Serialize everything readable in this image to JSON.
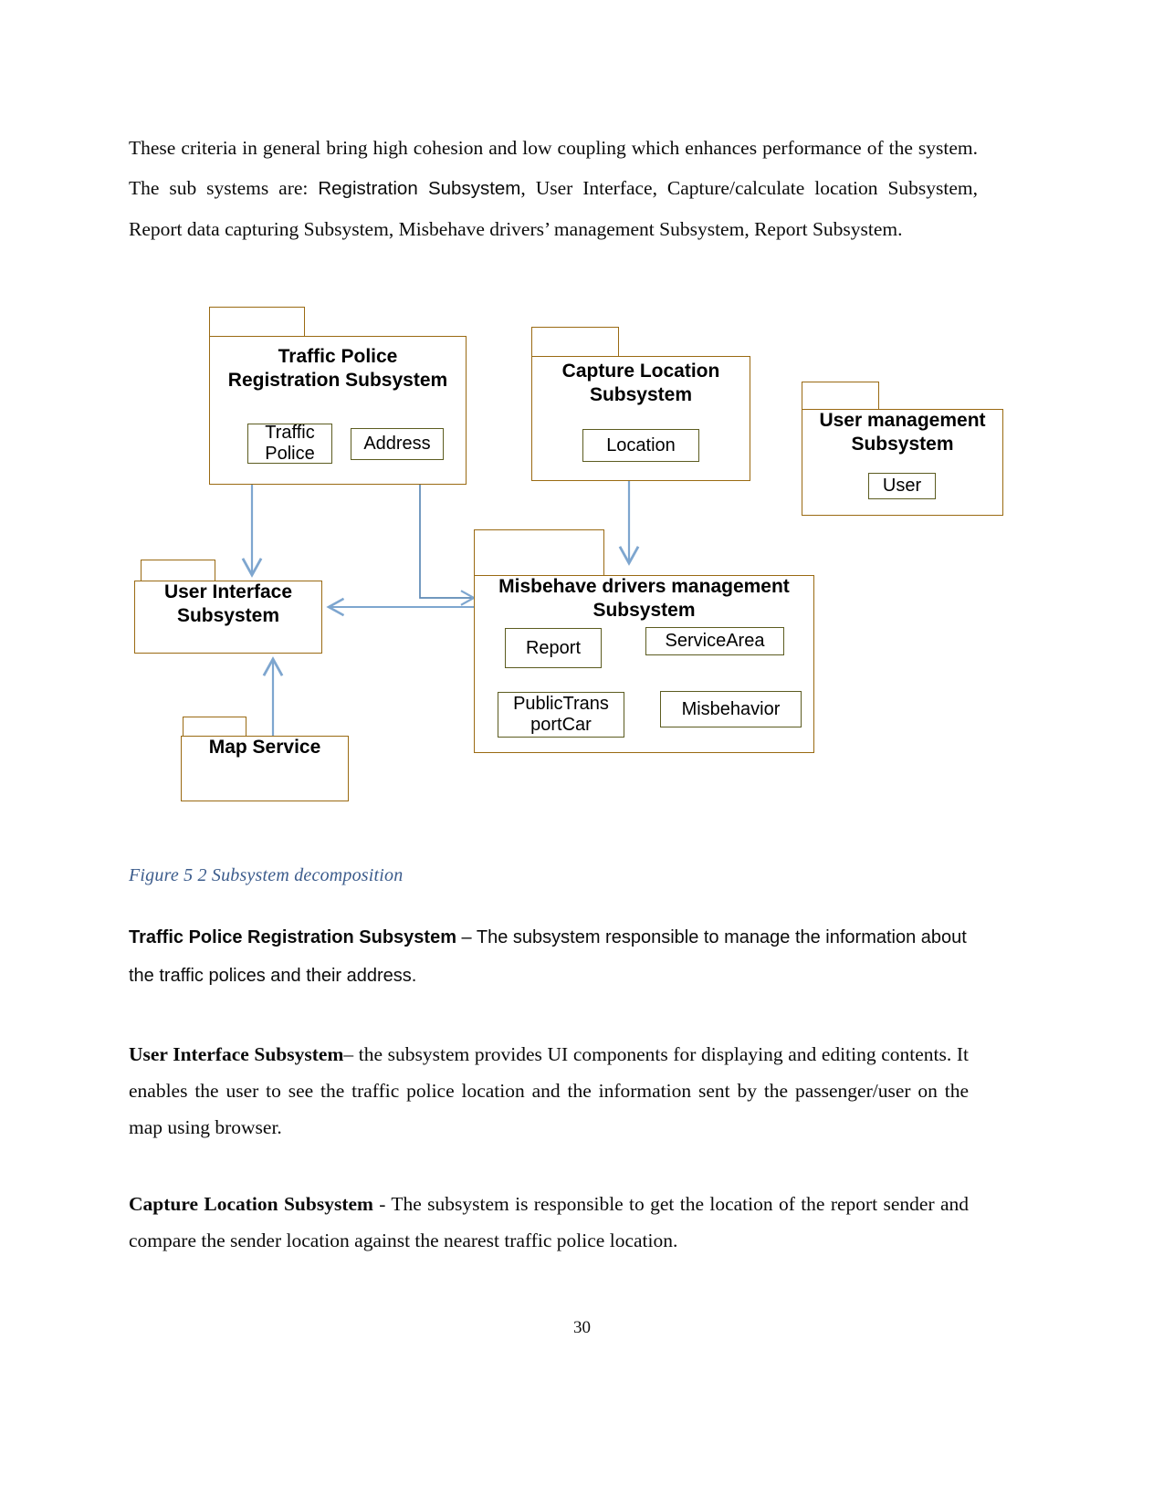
{
  "document": {
    "page_number": "30",
    "paragraphs": {
      "intro": "These criteria in general bring high cohesion and low coupling which enhances performance of the system. The sub systems are: Registration Subsystem, User Interface, Capture/calculate location Subsystem, Report data capturing Subsystem, Misbehave drivers’ management Subsystem, Report Subsystem.",
      "intro_part1": "These criteria in general bring high cohesion and low coupling which enhances performance of the system. The sub systems are: ",
      "intro_emph": "Registration Subsystem",
      "intro_part2": ", User Interface, Capture/calculate location Subsystem, Report data capturing Subsystem, Misbehave drivers’ management Subsystem, Report Subsystem.",
      "traffic_police_heading": "Traffic Police Registration Subsystem",
      "traffic_police_body": " – The subsystem responsible to manage the information about the traffic polices and their address.",
      "user_interface_heading": "User Interface Subsystem",
      "user_interface_body": "– the subsystem provides UI components for displaying and editing contents. It enables the user to see the traffic police location and the information sent by the passenger/user on the map using browser.",
      "capture_location_heading": "Capture Location Subsystem",
      "capture_location_body": " - The subsystem is responsible to get the location of the report sender and compare the sender location against the nearest traffic police location."
    },
    "figure_caption": "Figure 5 2 Subsystem decomposition"
  },
  "diagram": {
    "colors": {
      "package_border": "#9a6a12",
      "class_border": "#5c5c20",
      "arrow": "#6f9ccb",
      "association": "#3f5e88",
      "caption": "#3c5c8c"
    },
    "packages": [
      {
        "id": "traffic-police-registration",
        "title_line1": "Traffic Police",
        "title_line2": "Registration Subsystem",
        "classes": [
          {
            "id": "traffic-police",
            "label_line1": "Traffic",
            "label_line2": "Police"
          },
          {
            "id": "address",
            "label_line1": "Address",
            "label_line2": ""
          }
        ]
      },
      {
        "id": "capture-location",
        "title_line1": "Capture Location",
        "title_line2": "Subsystem",
        "classes": [
          {
            "id": "location",
            "label_line1": "Location",
            "label_line2": ""
          }
        ]
      },
      {
        "id": "user-management",
        "title_line1": "User management",
        "title_line2": "Subsystem",
        "classes": [
          {
            "id": "user",
            "label_line1": "User",
            "label_line2": ""
          }
        ]
      },
      {
        "id": "user-interface",
        "title_line1": "User Interface",
        "title_line2": "Subsystem",
        "classes": []
      },
      {
        "id": "misbehave-drivers-management",
        "title_line1": "Misbehave drivers management",
        "title_line2": "Subsystem",
        "classes": [
          {
            "id": "report",
            "label_line1": "Report",
            "label_line2": ""
          },
          {
            "id": "service-area",
            "label_line1": "ServiceArea",
            "label_line2": ""
          },
          {
            "id": "public-transport-car",
            "label_line1": "PublicTrans",
            "label_line2": "portCar"
          },
          {
            "id": "misbehavior",
            "label_line1": "Misbehavior",
            "label_line2": ""
          }
        ]
      },
      {
        "id": "map-service",
        "title_line1": "Map Service",
        "title_line2": "",
        "classes": []
      }
    ],
    "connections": [
      {
        "from": "traffic-police-registration",
        "to": "user-interface",
        "kind": "dependency-arrow"
      },
      {
        "from": "traffic-police-registration",
        "to": "misbehave-drivers-management",
        "kind": "dependency-arrow"
      },
      {
        "from": "capture-location",
        "to": "misbehave-drivers-management",
        "kind": "dependency-arrow"
      },
      {
        "from": "misbehave-drivers-management",
        "to": "user-interface",
        "kind": "dependency-arrow"
      },
      {
        "from": "map-service",
        "to": "user-interface",
        "kind": "dependency-arrow"
      },
      {
        "from": "traffic-police",
        "to": "address",
        "kind": "association"
      },
      {
        "from": "report",
        "to": "service-area",
        "kind": "association"
      },
      {
        "from": "report",
        "to": "public-transport-car",
        "kind": "association"
      },
      {
        "from": "report",
        "to": "misbehavior",
        "kind": "association"
      }
    ]
  }
}
